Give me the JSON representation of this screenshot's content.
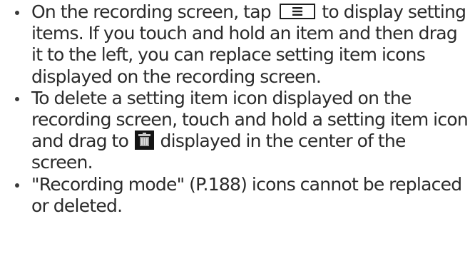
{
  "bullets": [
    {
      "text_before_icon": "On the recording screen, tap ",
      "icon": "menu-icon",
      "text_after_icon": " to display setting items. If you touch and hold an item and then drag it to the left, you can replace setting item icons displayed on the recording screen."
    },
    {
      "text_before_icon": "To delete a setting item icon displayed on the recording screen, touch and hold a setting item icon and drag to ",
      "icon": "trash-icon",
      "text_after_icon": " displayed in the center of the screen."
    },
    {
      "text": "\"Recording mode\" (P.188) icons cannot be replaced or deleted."
    }
  ],
  "colors": {
    "text": "#2b2b2b",
    "icon_border": "#1e1e1e",
    "trash_background": "#141414",
    "trash_metal": "#bfbfbf"
  }
}
